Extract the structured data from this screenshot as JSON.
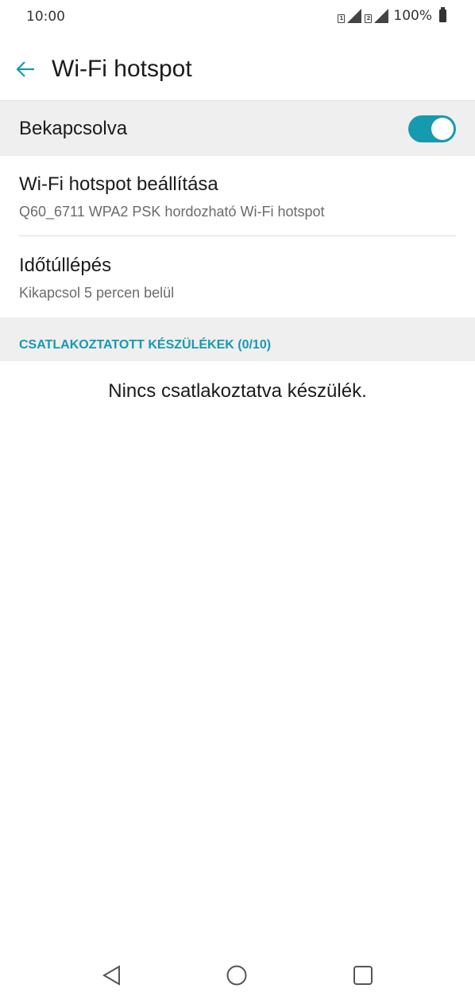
{
  "status_bar": {
    "time": "10:00",
    "sim1_label": "1",
    "sim2_label": "2",
    "battery": "100%"
  },
  "header": {
    "title": "Wi-Fi hotspot",
    "back_icon": "arrow-left-icon"
  },
  "toggle": {
    "label": "Bekapcsolva",
    "state": "on",
    "accent_color": "#169ab0"
  },
  "settings": [
    {
      "title": "Wi-Fi hotspot beállítása",
      "subtitle": "Q60_6711 WPA2 PSK hordozható Wi-Fi hotspot"
    },
    {
      "title": "Időtúllépés",
      "subtitle": "Kikapcsol 5 percen belül"
    }
  ],
  "section": {
    "label": "CSATLAKOZTATOTT KÉSZÜLÉKEK (0/10)"
  },
  "empty_message": "Nincs csatlakoztatva készülék.",
  "nav": {
    "back_icon": "triangle-back-icon",
    "home_icon": "circle-home-icon",
    "recents_icon": "square-recents-icon"
  }
}
